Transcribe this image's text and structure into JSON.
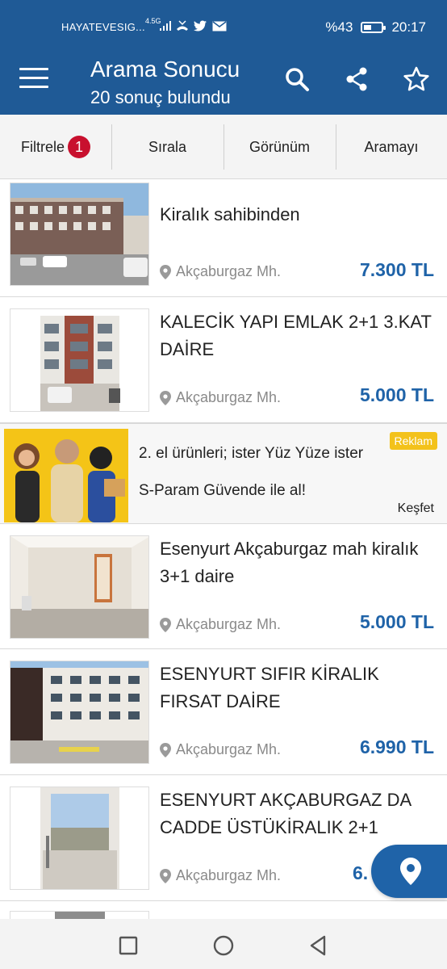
{
  "status_bar": {
    "carrier": "HAYATEVESIG...",
    "network": "4.5G",
    "battery": "%43",
    "battery_level": 0.43,
    "time": "20:17"
  },
  "app_bar": {
    "title": "Arama Sonucu",
    "subtitle": "20 sonuç bulundu",
    "icons": [
      "menu-icon",
      "search-icon",
      "share-icon",
      "star-icon"
    ]
  },
  "toolbar": {
    "filter_label": "Filtrele",
    "filter_count": "1",
    "sort_label": "Sırala",
    "view_label": "Görünüm",
    "save_label": "Aramayı Kaydet"
  },
  "listings": [
    {
      "title": "Kiralık sahibinden",
      "location": "Akçaburgaz Mh.",
      "price": "7.300 TL"
    },
    {
      "title": "KALECİK YAPI EMLAK 2+1 3.KAT DAİRE",
      "location": "Akçaburgaz Mh.",
      "price": "5.000 TL"
    },
    {
      "title": "Esenyurt Akçaburgaz mah kiralık 3+1 daire",
      "location": "Akçaburgaz Mh.",
      "price": "5.000 TL"
    },
    {
      "title": "ESENYURT SIFIR KİRALIK FIRSAT DAİRE",
      "location": "Akçaburgaz Mh.",
      "price": "6.990 TL"
    },
    {
      "title": "ESENYURT AKÇABURGAZ DA CADDE ÜSTÜKİRALIK 2+1",
      "location": "Akçaburgaz Mh.",
      "price": "6."
    }
  ],
  "ad": {
    "text": "2. el ürünleri; ister Yüz Yüze ister S-Param Güvende ile al!",
    "badge": "Reklam",
    "cta": "Keşfet"
  },
  "colors": {
    "primary": "#1f5a96",
    "price": "#1f63a8",
    "badge": "#c8102e",
    "ad_badge": "#f3c21b"
  }
}
